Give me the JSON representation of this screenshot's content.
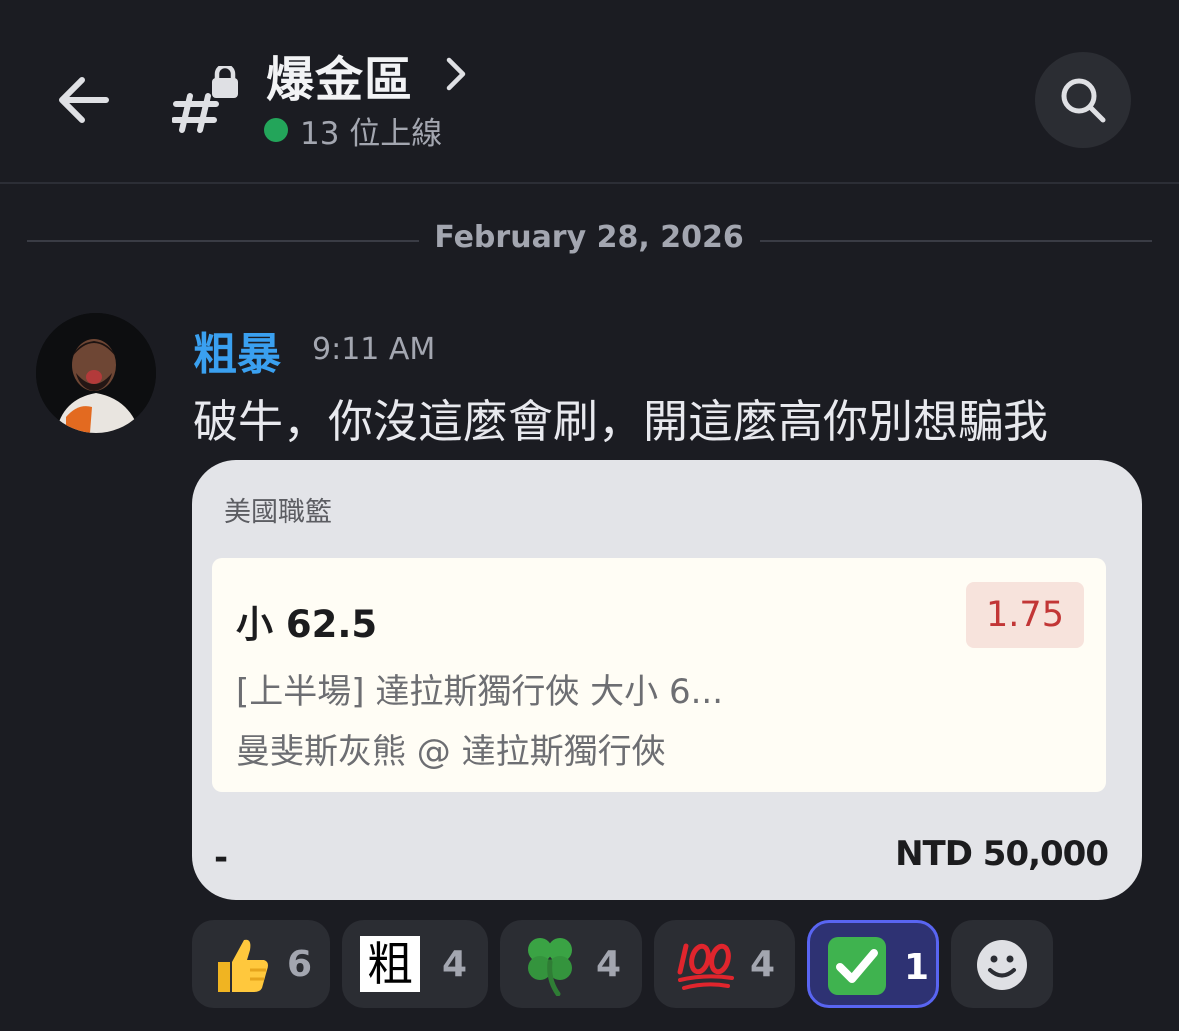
{
  "header": {
    "channel_name": "爆金區",
    "online_text": "13 位上線"
  },
  "date_divider": "February 28, 2026",
  "message": {
    "username": "粗暴",
    "timestamp": "9:11 AM",
    "text": "破牛，你沒這麼會刷，開這麼高你別想騙我",
    "bet_card": {
      "league": "美國職籃",
      "selection": "小 62.5",
      "odds": "1.75",
      "market": "[上半場] 達拉斯獨行俠 大小 6...",
      "match": "曼斐斯灰熊 @ 達拉斯獨行俠",
      "left_mark": "-",
      "stake": "NTD 50,000"
    }
  },
  "reactions": [
    {
      "emoji": "thumbs-up-icon",
      "count": "6"
    },
    {
      "emoji": "粗",
      "count": "4"
    },
    {
      "emoji": "four-leaf-clover-icon",
      "count": "4"
    },
    {
      "emoji": "hundred-points-icon",
      "count": "4"
    },
    {
      "emoji": "check-mark-button-icon",
      "count": "1",
      "selected": true
    },
    {
      "emoji": "add-reaction-icon"
    }
  ],
  "colors": {
    "background": "#1b1c22",
    "username": "#3aa0f0",
    "online": "#23a55a",
    "odds": "#c23636",
    "selected_reaction_border": "#5965f2"
  }
}
